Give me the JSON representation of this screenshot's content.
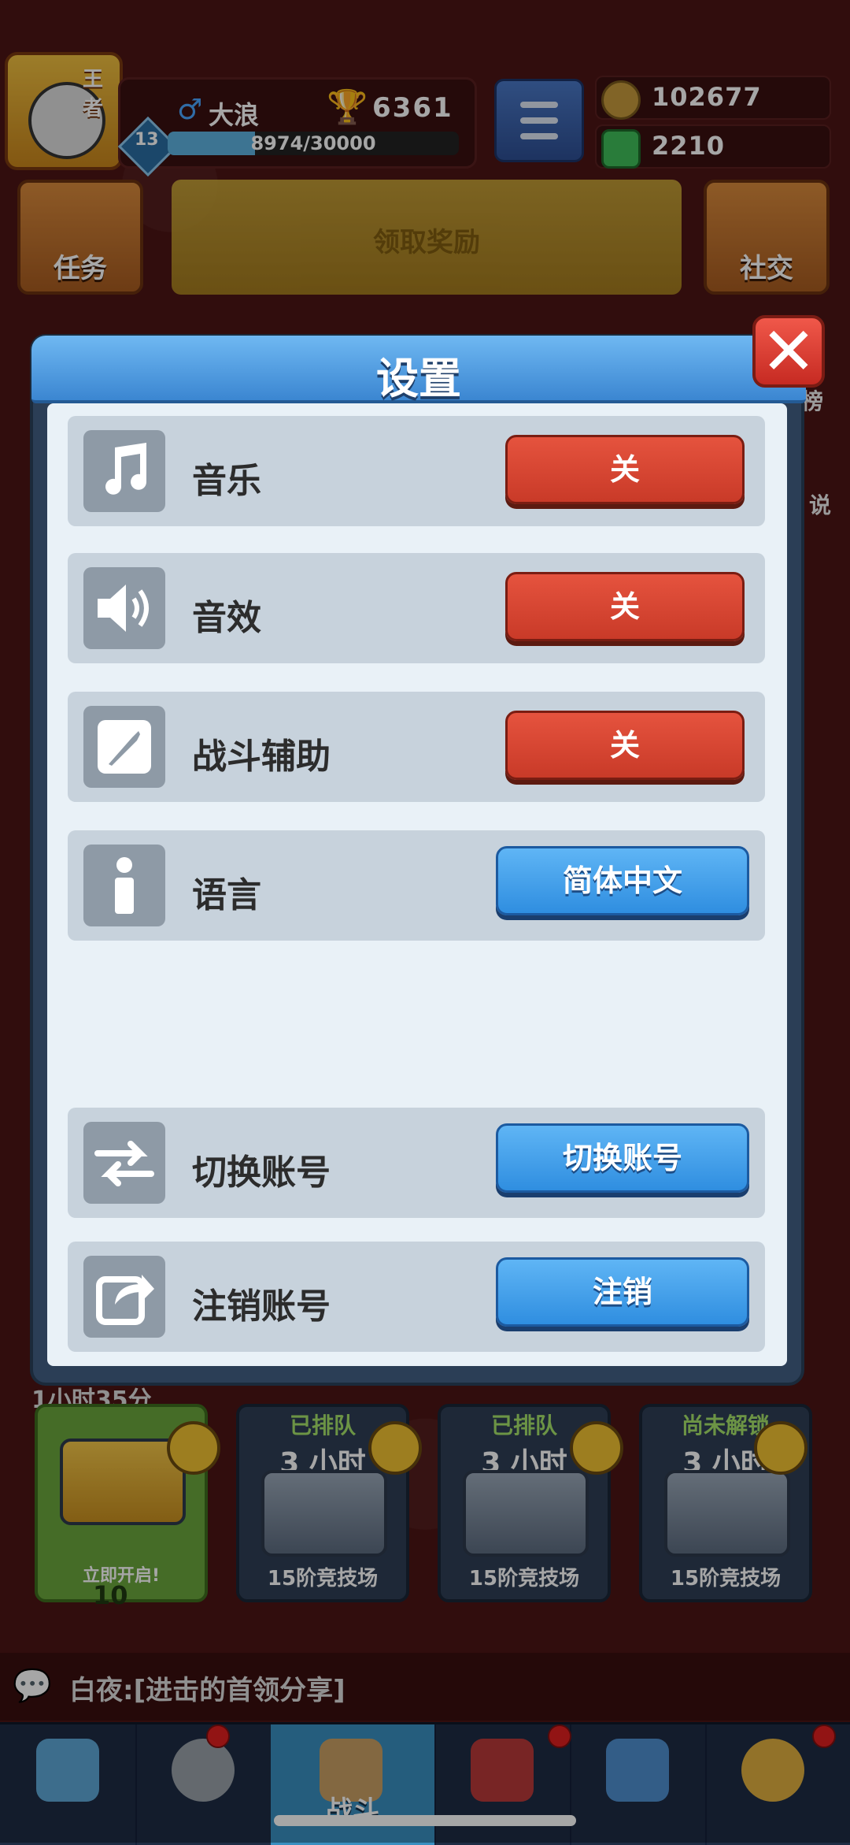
{
  "hud": {
    "crown_label": "王者",
    "gender_symbol": "♂",
    "player_name": "大浪",
    "trophies": "6361",
    "level": "13",
    "xp_text": "8974/30000",
    "xp_progress": 0.299,
    "gold": "102677",
    "gems": "2210"
  },
  "quick_buttons": {
    "tasks": "任务",
    "claim_reward": "领取奖励",
    "social": "社交"
  },
  "side_peek": {
    "right_top": "榜",
    "right_mid": "说"
  },
  "settings": {
    "title": "设置",
    "close": "✕",
    "rows": [
      {
        "label": "音乐",
        "button": "关",
        "icon": "music-icon"
      },
      {
        "label": "音效",
        "button": "关",
        "icon": "speaker-icon"
      },
      {
        "label": "战斗辅助",
        "button": "关",
        "icon": "sword-icon"
      },
      {
        "label": "语言",
        "button": "简体中文",
        "icon": "info-icon"
      },
      {
        "label": "切换账号",
        "button": "切换账号",
        "icon": "swap-icon"
      },
      {
        "label": "注销账号",
        "button": "注销",
        "icon": "share-exit-icon"
      }
    ]
  },
  "chests": {
    "timer": "1小时35分",
    "slots": [
      {
        "status": "",
        "time": "",
        "label": "立即开启!",
        "cost": "10"
      },
      {
        "status": "已排队",
        "time": "3 小时",
        "arena": "15阶竞技场"
      },
      {
        "status": "已排队",
        "time": "3 小时",
        "arena": "15阶竞技场"
      },
      {
        "status": "尚未解锁",
        "time": "3 小时",
        "arena": "15阶竞技场"
      }
    ]
  },
  "chat": {
    "message": "白夜:[进击的首领分享]"
  },
  "nav": {
    "battle": "战斗"
  },
  "colors": {
    "red_button": "#d8452f",
    "blue_button": "#3d9be8",
    "header_blue": "#4a9ae0"
  }
}
